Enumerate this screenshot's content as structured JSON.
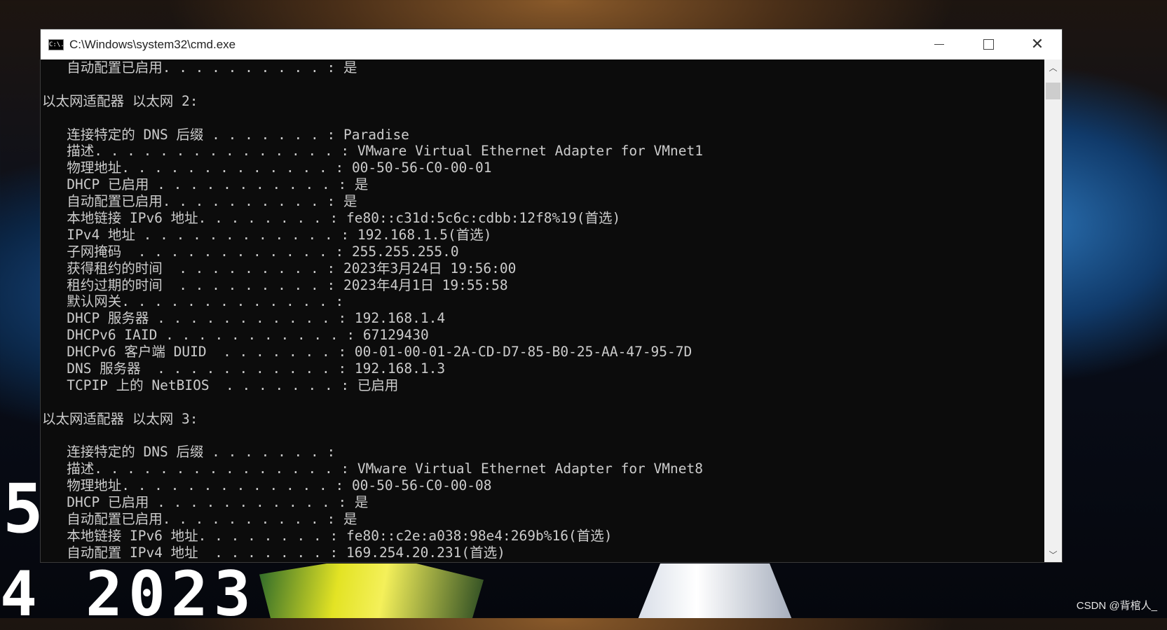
{
  "window": {
    "title": "C:\\Windows\\system32\\cmd.exe",
    "icon": "cmd-icon",
    "icon_text": "C:\\."
  },
  "controls": {
    "minimize": "minimize-icon",
    "maximize": "maximize-icon",
    "close": "✕"
  },
  "console": {
    "lines": [
      "   自动配置已启用. . . . . . . . . . : 是",
      "",
      "以太网适配器 以太网 2:",
      "",
      "   连接特定的 DNS 后缀 . . . . . . . : Paradise",
      "   描述. . . . . . . . . . . . . . . : VMware Virtual Ethernet Adapter for VMnet1",
      "   物理地址. . . . . . . . . . . . . : 00-50-56-C0-00-01",
      "   DHCP 已启用 . . . . . . . . . . . : 是",
      "   自动配置已启用. . . . . . . . . . : 是",
      "   本地链接 IPv6 地址. . . . . . . . : fe80::c31d:5c6c:cdbb:12f8%19(首选)",
      "   IPv4 地址 . . . . . . . . . . . . : 192.168.1.5(首选)",
      "   子网掩码  . . . . . . . . . . . . : 255.255.255.0",
      "   获得租约的时间  . . . . . . . . . : 2023年3月24日 19:56:00",
      "   租约过期的时间  . . . . . . . . . : 2023年4月1日 19:55:58",
      "   默认网关. . . . . . . . . . . . . :",
      "   DHCP 服务器 . . . . . . . . . . . : 192.168.1.4",
      "   DHCPv6 IAID . . . . . . . . . . . : 67129430",
      "   DHCPv6 客户端 DUID  . . . . . . . : 00-01-00-01-2A-CD-D7-85-B0-25-AA-47-95-7D",
      "   DNS 服务器  . . . . . . . . . . . : 192.168.1.3",
      "   TCPIP 上的 NetBIOS  . . . . . . . : 已启用",
      "",
      "以太网适配器 以太网 3:",
      "",
      "   连接特定的 DNS 后缀 . . . . . . . :",
      "   描述. . . . . . . . . . . . . . . : VMware Virtual Ethernet Adapter for VMnet8",
      "   物理地址. . . . . . . . . . . . . : 00-50-56-C0-00-08",
      "   DHCP 已启用 . . . . . . . . . . . : 是",
      "   自动配置已启用. . . . . . . . . . : 是",
      "   本地链接 IPv6 地址. . . . . . . . : fe80::c2e:a038:98e4:269b%16(首选)",
      "   自动配置 IPv4 地址  . . . . . . . : 169.254.20.231(首选)"
    ]
  },
  "desktop": {
    "clock_digit": "5",
    "clock_date": "4 2023",
    "watermark": "CSDN @背棺人_"
  }
}
